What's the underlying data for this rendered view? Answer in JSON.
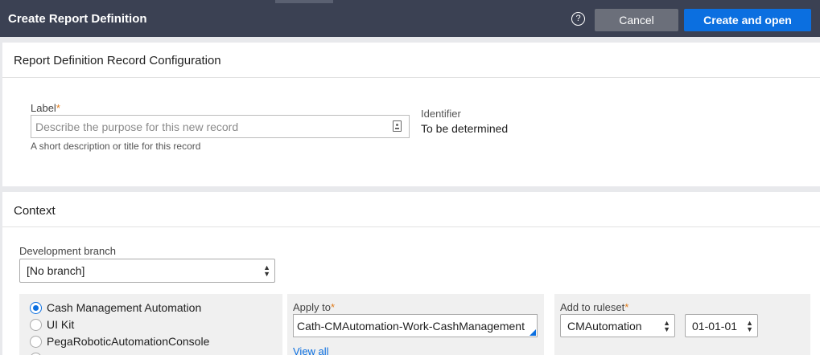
{
  "header": {
    "title": "Create Report Definition",
    "help_glyph": "?",
    "cancel_label": "Cancel",
    "create_label": "Create and open"
  },
  "record_config": {
    "title": "Report Definition Record Configuration",
    "label_field": {
      "label": "Label",
      "required_mark": "*",
      "value": "",
      "placeholder": "Describe the purpose for this new record",
      "help_text": "A short description or title for this record"
    },
    "identifier": {
      "label": "Identifier",
      "value": "To be determined"
    }
  },
  "context": {
    "title": "Context",
    "branch": {
      "label": "Development branch",
      "selected": "[No branch]"
    },
    "applications": [
      {
        "label": "Cash Management Automation",
        "selected": true
      },
      {
        "label": "UI Kit",
        "selected": false
      },
      {
        "label": "PegaRoboticAutomationConsole",
        "selected": false
      }
    ],
    "apply_to": {
      "label": "Apply to",
      "required_mark": "*",
      "value": "Cath-CMAutomation-Work-CashManagement",
      "view_all": "View all"
    },
    "ruleset": {
      "label": "Add to ruleset",
      "required_mark": "*",
      "selected": "CMAutomation",
      "version": "01-01-01"
    }
  },
  "colors": {
    "header_bg": "#3b4153",
    "primary": "#0b6fe0",
    "cancel_bg": "#6b6f7a",
    "required": "#e07b1a"
  },
  "icons": {
    "help": "help-icon",
    "clipboard": "clipboard-icon",
    "select_arrows": "select-arrows-icon"
  }
}
